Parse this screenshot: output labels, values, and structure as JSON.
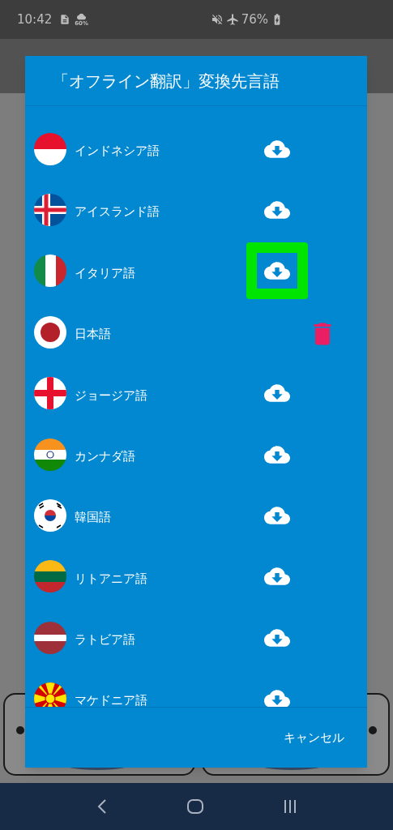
{
  "status_bar": {
    "time": "10:42",
    "weather_percent": "60%",
    "battery": "76%"
  },
  "dialog": {
    "title": "「オフライン翻訳」変換先言語",
    "languages": [
      {
        "name": "インドネシア語",
        "kind": "download",
        "highlighted": false
      },
      {
        "name": "アイスランド語",
        "kind": "download",
        "highlighted": false
      },
      {
        "name": "イタリア語",
        "kind": "download",
        "highlighted": true
      },
      {
        "name": "日本語",
        "kind": "delete",
        "highlighted": false
      },
      {
        "name": "ジョージア語",
        "kind": "download",
        "highlighted": false
      },
      {
        "name": "カンナダ語",
        "kind": "download",
        "highlighted": false
      },
      {
        "name": "韓国語",
        "kind": "download",
        "highlighted": false
      },
      {
        "name": "リトアニア語",
        "kind": "download",
        "highlighted": false
      },
      {
        "name": "ラトビア語",
        "kind": "download",
        "highlighted": false
      },
      {
        "name": "マケドニア語",
        "kind": "download",
        "highlighted": false
      }
    ],
    "cancel_button": "キャンセル"
  }
}
